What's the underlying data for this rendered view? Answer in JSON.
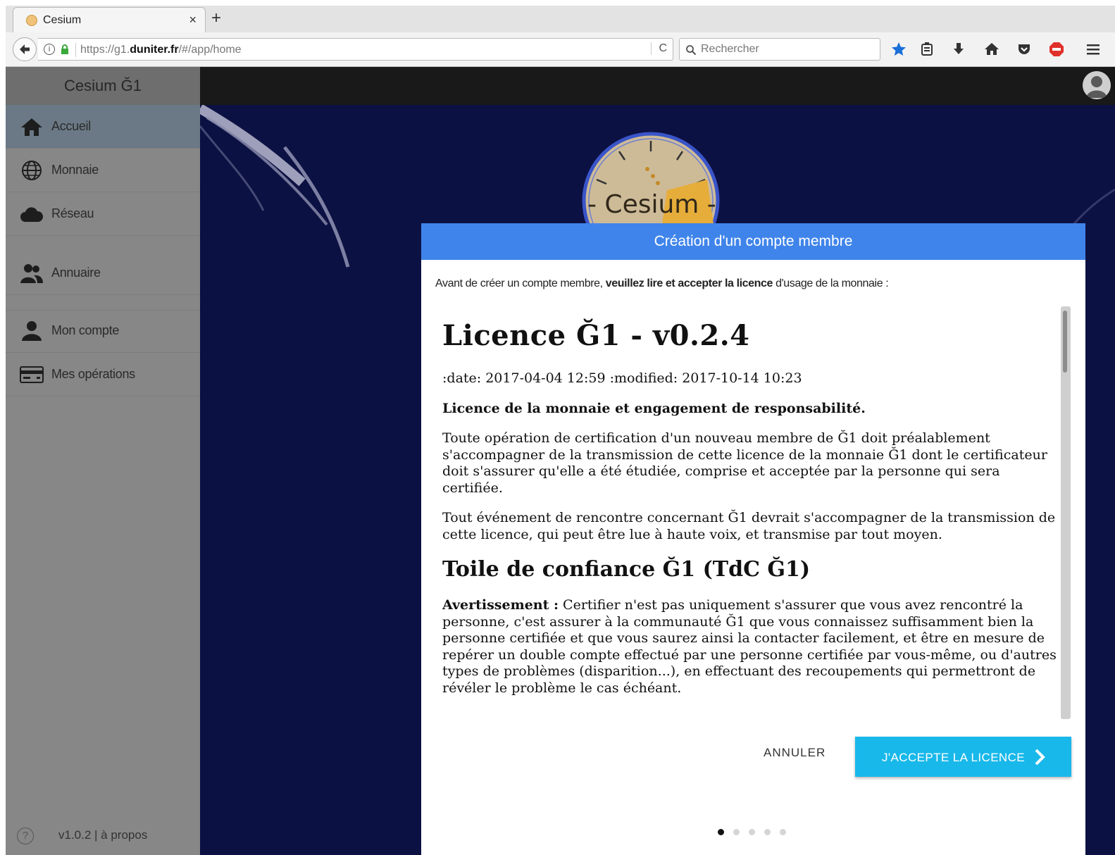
{
  "browser": {
    "tab_title": "Cesium",
    "tab_close": "×",
    "new_tab": "+",
    "url_prefix": "https://g1.",
    "url_domain": "duniter.fr",
    "url_path": "/#/app/home",
    "reload": "C",
    "search_placeholder": "Rechercher"
  },
  "sidebar": {
    "title": "Cesium Ğ1",
    "items": [
      {
        "label": "Accueil",
        "icon": "home-icon",
        "active": true
      },
      {
        "label": "Monnaie",
        "icon": "globe-icon"
      },
      {
        "label": "Réseau",
        "icon": "cloud-icon"
      },
      {
        "label": "Annuaire",
        "icon": "people-icon"
      },
      {
        "label": "Mon compte",
        "icon": "person-icon"
      },
      {
        "label": "Mes opérations",
        "icon": "card-icon"
      }
    ],
    "footer": "v1.0.2 | à propos"
  },
  "background": {
    "logo_text": "- Cesium -"
  },
  "modal": {
    "title": "Création d'un compte membre",
    "intro_before": "Avant de créer un compte membre, ",
    "intro_bold": "veuillez lire et accepter la licence",
    "intro_after": " d'usage de la monnaie :",
    "license": {
      "heading": "Licence Ğ1 - v0.2.4",
      "dates": ":date: 2017-04-04 12:59 :modified: 2017-10-14 10:23",
      "subtitle": "Licence de la monnaie et engagement de responsabilité.",
      "p1": "Toute opération de certification d'un nouveau membre de Ğ1 doit préalablement s'accompagner de la transmission de cette licence de la monnaie Ğ1 dont le certificateur doit s'assurer qu'elle a été étudiée, comprise et acceptée par la personne qui sera certifiée.",
      "p2": "Tout événement de rencontre concernant Ğ1 devrait s'accompagner de la transmission de cette licence, qui peut être lue à haute voix, et transmise par tout moyen.",
      "h2": "Toile de confiance Ğ1 (TdC Ğ1)",
      "warn_label": "Avertissement :",
      "warn_text": " Certifier n'est pas uniquement s'assurer que vous avez rencontré la personne, c'est assurer à la communauté Ğ1 que vous connaissez suffisamment bien la personne certifiée et que vous saurez ainsi la contacter facilement, et être en mesure de repérer un double compte effectué par une personne certifiée par vous-même, ou d'autres types de problèmes (disparition...), en effectuant des recoupements qui permettront de révéler le problème le cas échéant."
    },
    "cancel_label": "ANNULER",
    "accept_label": "J'ACCEPTE LA LICENCE",
    "pager": {
      "total": 5,
      "current": 1
    }
  }
}
